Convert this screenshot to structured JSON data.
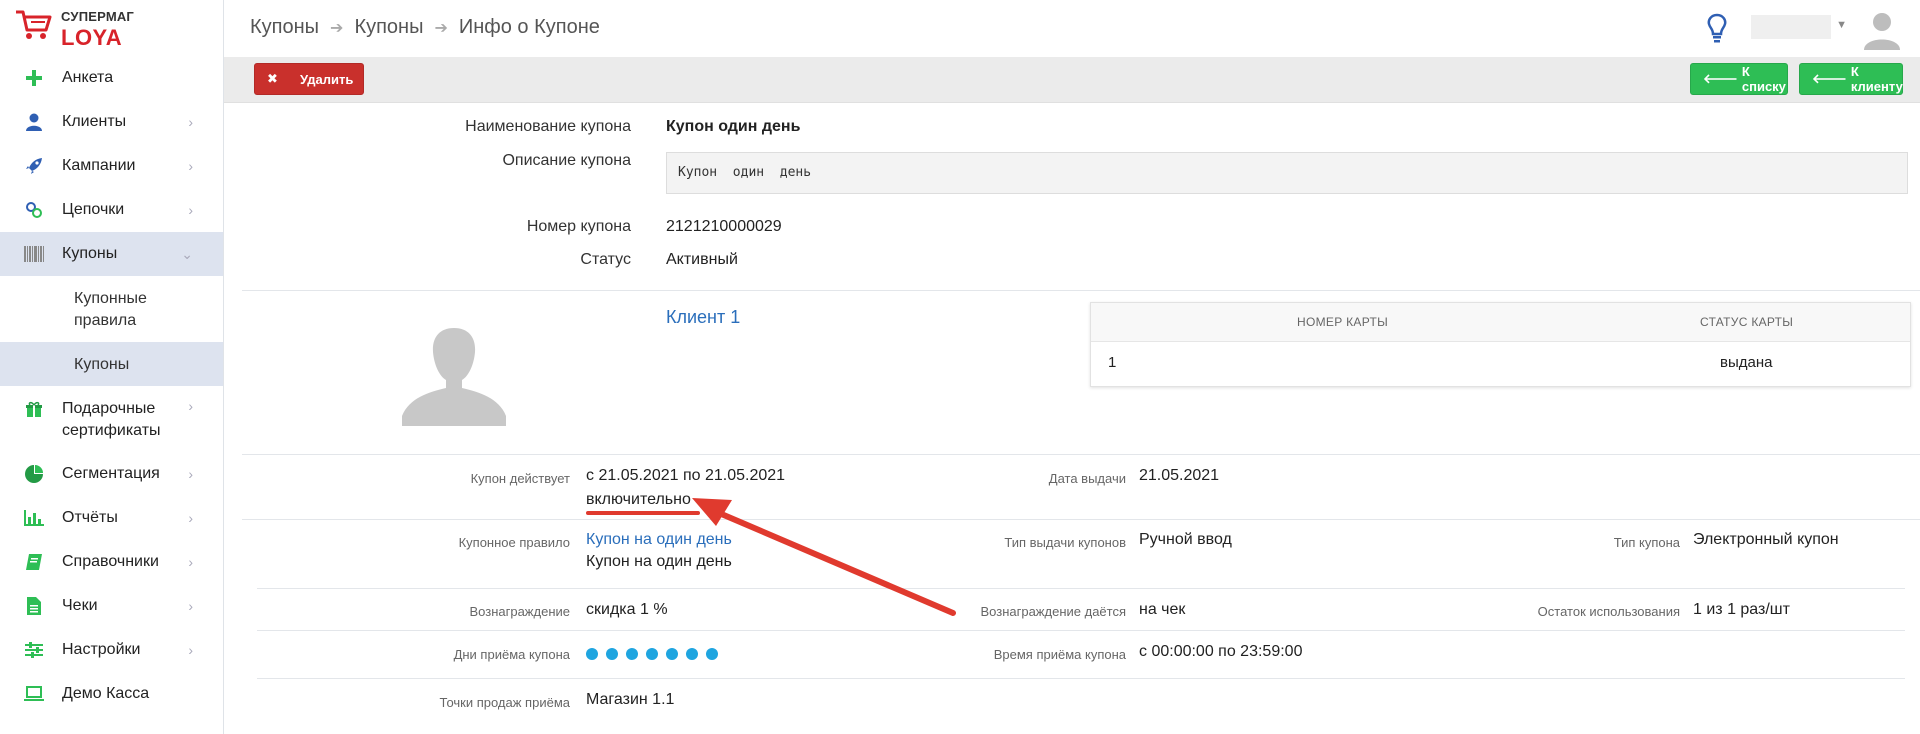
{
  "logo": {
    "top": "СУПЕРМАГ",
    "bottom": "LOYA"
  },
  "sidebar": {
    "items": [
      {
        "label": "Анкета",
        "icon": "plus-icon"
      },
      {
        "label": "Клиенты",
        "icon": "user-icon"
      },
      {
        "label": "Кампании",
        "icon": "rocket-icon"
      },
      {
        "label": "Цепочки",
        "icon": "chain-icon"
      },
      {
        "label": "Купоны",
        "icon": "barcode-icon"
      },
      {
        "label": "Подарочные сертификаты",
        "icon": "gift-icon"
      },
      {
        "label": "Сегментация",
        "icon": "pie-chart-icon"
      },
      {
        "label": "Отчёты",
        "icon": "bar-chart-icon"
      },
      {
        "label": "Справочники",
        "icon": "book-icon"
      },
      {
        "label": "Чеки",
        "icon": "document-icon"
      },
      {
        "label": "Настройки",
        "icon": "sliders-icon"
      },
      {
        "label": "Демо Касса",
        "icon": "laptop-icon"
      }
    ],
    "sub_items": [
      {
        "label": "Купонные правила"
      },
      {
        "label": "Купоны"
      }
    ]
  },
  "header": {
    "breadcrumb": [
      "Купоны",
      "Купоны",
      "Инфо о Купоне"
    ]
  },
  "toolbar": {
    "delete_label": "Удалить",
    "to_list_label": "К списку",
    "to_client_label": "К клиенту"
  },
  "coupon": {
    "name_label": "Наименование купона",
    "name_value": "Купон один день",
    "desc_label": "Описание купона",
    "desc_value": "Купон  один  день",
    "number_label": "Номер купона",
    "number_value": "2121210000029",
    "status_label": "Статус",
    "status_value": "Активный"
  },
  "client": {
    "name": "Клиент 1",
    "table": {
      "headers": [
        "НОМЕР КАРТЫ",
        "СТАТУС КАРТЫ"
      ],
      "rows": [
        [
          "1",
          "выдана"
        ]
      ]
    }
  },
  "details": {
    "valid_label": "Купон действует",
    "valid_value": "с 21.05.2021 по 21.05.2021",
    "valid_suffix": "включительно",
    "issue_date_label": "Дата выдачи",
    "issue_date_value": "21.05.2021",
    "rule_label": "Купонное правило",
    "rule_link": "Купон на один день",
    "rule_desc": "Купон на один день",
    "issue_type_label": "Тип выдачи купонов",
    "issue_type_value": "Ручной ввод",
    "coupon_type_label": "Тип купона",
    "coupon_type_value": "Электронный купон",
    "reward_label": "Вознаграждение",
    "reward_value": "скидка 1 %",
    "reward_given_label": "Вознаграждение даётся",
    "reward_given_value": "на чек",
    "usage_left_label": "Остаток использования",
    "usage_left_value": "1 из 1 раз/шт",
    "days_label": "Дни приёма купона",
    "days_count": 7,
    "time_label": "Время приёма купона",
    "time_value": "с 00:00:00 по 23:59:00",
    "points_label": "Точки продаж приёма",
    "points_value": "Магазин 1.1"
  },
  "colors": {
    "accent_red": "#c9302c",
    "accent_green": "#2ebe55",
    "link_blue": "#2a6ebb",
    "dot_blue": "#1fa5e0",
    "sidebar_active": "#dde3ef"
  }
}
